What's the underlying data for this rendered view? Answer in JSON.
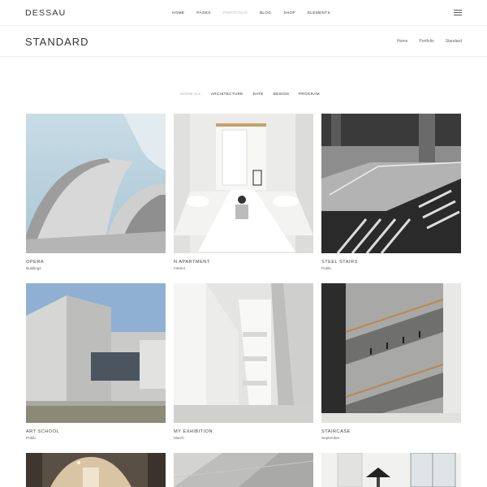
{
  "header": {
    "logo": "DESSAU",
    "nav": [
      "HOME",
      "PAGES",
      "PORTFOLIO",
      "BLOG",
      "SHOP",
      "ELEMENTS"
    ],
    "active_nav": "PORTFOLIO",
    "menu_icon": "hamburger-menu-icon"
  },
  "titlebar": {
    "title": "STANDARD",
    "breadcrumb": [
      "Home",
      "Portfolio",
      "Standard"
    ]
  },
  "filters": {
    "items": [
      "SHOW ALL",
      "ARCHITECTURE",
      "DATE",
      "DESIGN",
      "PROGRAM"
    ],
    "active": "SHOW ALL"
  },
  "portfolio": {
    "items": [
      {
        "title": "OPERA",
        "category": "Buildings"
      },
      {
        "title": "N APARTMENT",
        "category": "Interior"
      },
      {
        "title": "STEEL STAIRS",
        "category": "Public"
      },
      {
        "title": "ART SCHOOL",
        "category": "Public"
      },
      {
        "title": "MY EXHIBITION",
        "category": "March"
      },
      {
        "title": "STAIRCASE",
        "category": "September"
      },
      {
        "title": "",
        "category": ""
      },
      {
        "title": "",
        "category": ""
      },
      {
        "title": "",
        "category": ""
      }
    ]
  },
  "colors": {
    "text": "#333333",
    "muted": "#aaaaaa",
    "divider": "#ededed",
    "sky": "#b9d2df",
    "concrete": "#c9c9c9"
  }
}
